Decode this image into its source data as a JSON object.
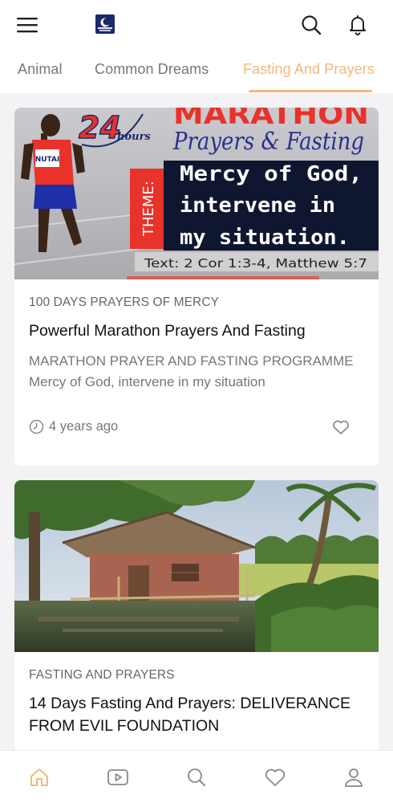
{
  "header": {
    "menu_icon": "hamburger-menu-icon",
    "logo_icon": "app-logo-icon",
    "search_icon": "search-icon",
    "bell_icon": "bell-icon"
  },
  "tabs": [
    {
      "label": "Animal",
      "active": false
    },
    {
      "label": "Common Dreams",
      "active": false
    },
    {
      "label": "Fasting And Prayers",
      "active": true
    }
  ],
  "accent_color": "#f3b87b",
  "posts": [
    {
      "category": "100 DAYS PRAYERS OF MERCY",
      "title": "Powerful Marathon Prayers And Fasting",
      "excerpt": "MARATHON PRAYER AND FASTING PROGRAMME Mercy of God, intervene in my situation",
      "time": "4 years ago",
      "image": {
        "badge": "24",
        "badge_sub": "hours",
        "headline": "MARATHON",
        "subheadline": "Prayers & Fasting",
        "theme_label": "THEME:",
        "theme_lines": [
          "Mercy of God,",
          "intervene in",
          "my situation."
        ],
        "scripture": "Text: 2 Cor 1:3-4, Matthew 5:7",
        "runner_bib": "NUTAI"
      }
    },
    {
      "category": "FASTING AND PRAYERS",
      "title": "14 Days Fasting And Prayers: DELIVERANCE FROM EVIL FOUNDATION"
    }
  ],
  "bottom_nav": [
    {
      "icon": "home-icon",
      "active": true
    },
    {
      "icon": "video-play-icon",
      "active": false
    },
    {
      "icon": "search-icon",
      "active": false
    },
    {
      "icon": "heart-icon",
      "active": false
    },
    {
      "icon": "user-icon",
      "active": false
    }
  ]
}
